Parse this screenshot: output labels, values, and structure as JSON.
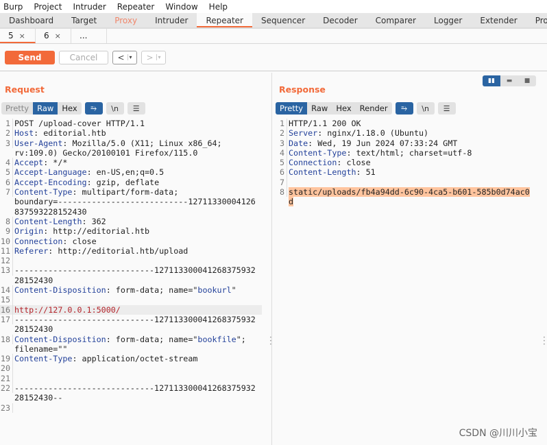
{
  "menu": [
    "Burp",
    "Project",
    "Intruder",
    "Repeater",
    "Window",
    "Help"
  ],
  "tabs": [
    "Dashboard",
    "Target",
    "Proxy",
    "Intruder",
    "Repeater",
    "Sequencer",
    "Decoder",
    "Comparer",
    "Logger",
    "Extender",
    "Project o"
  ],
  "active_tab": "Repeater",
  "subtabs": [
    {
      "label": "5",
      "close": "×"
    },
    {
      "label": "6",
      "close": "×"
    },
    {
      "label": "..."
    }
  ],
  "toolbar": {
    "send": "Send",
    "cancel": "Cancel",
    "back": "<",
    "forward": ">",
    "dropdown": "▾"
  },
  "colors": {
    "accent": "#f26a3a",
    "selected": "#2a64a2",
    "header_key": "#23419a",
    "url": "#b3232a",
    "highlight": "#ffc49e"
  },
  "request": {
    "title": "Request",
    "views": [
      "Pretty",
      "Raw",
      "Hex"
    ],
    "active_view": "Raw",
    "icons": {
      "wrap": "⥱",
      "newline": "\\n",
      "menu": "☰"
    },
    "rows": [
      {
        "n": "1",
        "s": [
          [
            "POST /upload-cover HTTP/1.1",
            ""
          ]
        ]
      },
      {
        "n": "2",
        "s": [
          [
            "Host",
            "k"
          ],
          [
            ": editorial.htb",
            ""
          ]
        ]
      },
      {
        "n": "3",
        "s": [
          [
            "User-Agent",
            "k"
          ],
          [
            ": Mozilla/5.0 (X11; Linux x86_64;",
            ""
          ]
        ]
      },
      {
        "n": "",
        "s": [
          [
            "rv:109.0) Gecko/20100101 Firefox/115.0",
            ""
          ]
        ]
      },
      {
        "n": "4",
        "s": [
          [
            "Accept",
            "k"
          ],
          [
            ": */*",
            ""
          ]
        ]
      },
      {
        "n": "5",
        "s": [
          [
            "Accept-Language",
            "k"
          ],
          [
            ": en-US,en;q=0.5",
            ""
          ]
        ]
      },
      {
        "n": "6",
        "s": [
          [
            "Accept-Encoding",
            "k"
          ],
          [
            ": gzip, deflate",
            ""
          ]
        ]
      },
      {
        "n": "7",
        "s": [
          [
            "Content-Type",
            "k"
          ],
          [
            ": multipart/form-data;",
            ""
          ]
        ]
      },
      {
        "n": "",
        "s": [
          [
            "boundary=---------------------------12711330004126",
            ""
          ]
        ]
      },
      {
        "n": "",
        "s": [
          [
            "837593228152430",
            ""
          ]
        ]
      },
      {
        "n": "8",
        "s": [
          [
            "Content-Length",
            "k"
          ],
          [
            ": 362",
            ""
          ]
        ]
      },
      {
        "n": "9",
        "s": [
          [
            "Origin",
            "k"
          ],
          [
            ": http://editorial.htb",
            ""
          ]
        ]
      },
      {
        "n": "10",
        "s": [
          [
            "Connection",
            "k"
          ],
          [
            ": close",
            ""
          ]
        ]
      },
      {
        "n": "11",
        "s": [
          [
            "Referer",
            "k"
          ],
          [
            ": http://editorial.htb/upload",
            ""
          ]
        ]
      },
      {
        "n": "12",
        "s": []
      },
      {
        "n": "13",
        "s": [
          [
            "-----------------------------127113300041268375932",
            ""
          ]
        ]
      },
      {
        "n": "",
        "s": [
          [
            "28152430",
            ""
          ]
        ]
      },
      {
        "n": "14",
        "s": [
          [
            "Content-Disposition",
            "k"
          ],
          [
            ": form-data; name=\"",
            ""
          ],
          [
            "bookurl",
            "q"
          ],
          [
            "\"",
            ""
          ]
        ]
      },
      {
        "n": "15",
        "s": []
      },
      {
        "n": "16",
        "s": [
          [
            "http://127.0.0.1:5000/",
            "u"
          ]
        ],
        "hl": true
      },
      {
        "n": "17",
        "s": [
          [
            "-----------------------------127113300041268375932",
            ""
          ]
        ]
      },
      {
        "n": "",
        "s": [
          [
            "28152430",
            ""
          ]
        ]
      },
      {
        "n": "18",
        "s": [
          [
            "Content-Disposition",
            "k"
          ],
          [
            ": form-data; name=\"",
            ""
          ],
          [
            "bookfile",
            "q"
          ],
          [
            "\";",
            ""
          ]
        ]
      },
      {
        "n": "",
        "s": [
          [
            "filename=\"\"",
            ""
          ]
        ]
      },
      {
        "n": "19",
        "s": [
          [
            "Content-Type",
            "k"
          ],
          [
            ": application/octet-stream",
            ""
          ]
        ]
      },
      {
        "n": "20",
        "s": []
      },
      {
        "n": "21",
        "s": []
      },
      {
        "n": "22",
        "s": [
          [
            "-----------------------------127113300041268375932",
            ""
          ]
        ]
      },
      {
        "n": "",
        "s": [
          [
            "28152430--",
            ""
          ]
        ]
      },
      {
        "n": "23",
        "s": []
      }
    ]
  },
  "response": {
    "title": "Response",
    "views": [
      "Pretty",
      "Raw",
      "Hex",
      "Render"
    ],
    "active_view": "Pretty",
    "icons": {
      "wrap": "⥱",
      "newline": "\\n",
      "menu": "☰"
    },
    "rows": [
      {
        "n": "1",
        "s": [
          [
            "HTTP/1.1 200 OK",
            ""
          ]
        ]
      },
      {
        "n": "2",
        "s": [
          [
            "Server",
            "k"
          ],
          [
            ": nginx/1.18.0 (Ubuntu)",
            ""
          ]
        ]
      },
      {
        "n": "3",
        "s": [
          [
            "Date",
            "k"
          ],
          [
            ": Wed, 19 Jun 2024 07:33:24 GMT",
            ""
          ]
        ]
      },
      {
        "n": "4",
        "s": [
          [
            "Content-Type",
            "k"
          ],
          [
            ": text/html; charset=utf-8",
            ""
          ]
        ]
      },
      {
        "n": "5",
        "s": [
          [
            "Connection",
            "k"
          ],
          [
            ": close",
            ""
          ]
        ]
      },
      {
        "n": "6",
        "s": [
          [
            "Content-Length",
            "k"
          ],
          [
            ": 51",
            ""
          ]
        ]
      },
      {
        "n": "7",
        "s": []
      },
      {
        "n": "8",
        "s": [
          [
            "static/uploads/fb4a94dd-6c90-4ca5-b601-585b0d74ac0",
            "mark"
          ]
        ]
      },
      {
        "n": "",
        "s": [
          [
            "d",
            "mark"
          ]
        ]
      }
    ]
  },
  "layout_icons": [
    "split-horizontal-icon",
    "split-vertical-icon",
    "tabs-icon"
  ],
  "watermark": "CSDN @川川小宝"
}
